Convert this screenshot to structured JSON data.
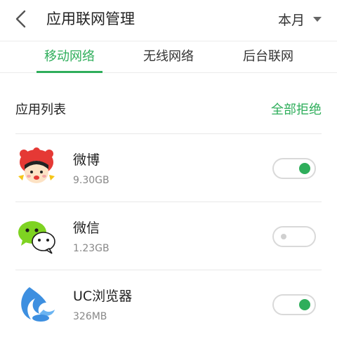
{
  "header": {
    "title": "应用联网管理",
    "period": "本月",
    "back_icon": "back-chevron-icon",
    "dropdown_icon": "caret-down-icon"
  },
  "tabs": [
    {
      "label": "移动网络",
      "active": true
    },
    {
      "label": "无线网络",
      "active": false
    },
    {
      "label": "后台联网",
      "active": false
    }
  ],
  "section": {
    "title": "应用列表",
    "action": "全部拒绝"
  },
  "apps": [
    {
      "name": "微博",
      "size": "9.30GB",
      "icon": "weibo-mascot-icon",
      "enabled": true
    },
    {
      "name": "微信",
      "size": "1.23GB",
      "icon": "wechat-icon",
      "enabled": false
    },
    {
      "name": "UC浏览器",
      "size": "326MB",
      "icon": "uc-browser-icon",
      "enabled": true
    }
  ],
  "colors": {
    "accent": "#2fae5b",
    "toggle_border": "#d9d9d9"
  }
}
